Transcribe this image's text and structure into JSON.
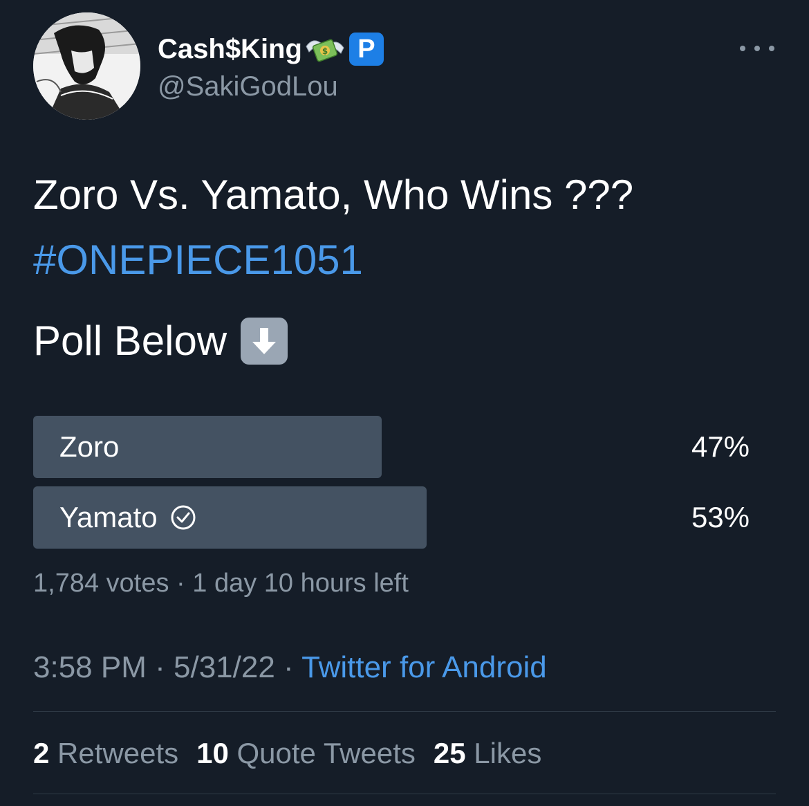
{
  "author": {
    "display_name": "Cash$King",
    "handle": "@SakiGodLou",
    "badge_letter": "P",
    "name_emoji": "money-with-wings-icon"
  },
  "tweet": {
    "text": "Zoro Vs. Yamato, Who Wins ???",
    "hashtag": "#ONEPIECE1051",
    "poll_intro": "Poll Below",
    "poll_intro_emoji": "down-arrow-icon"
  },
  "poll": {
    "options": [
      {
        "label": "Zoro",
        "percent_label": "47%",
        "percent": 47,
        "winner": false
      },
      {
        "label": "Yamato",
        "percent_label": "53%",
        "percent": 53,
        "winner": true
      }
    ],
    "votes": "1,784 votes",
    "separator": "·",
    "time_left": "1 day 10 hours left"
  },
  "meta": {
    "time": "3:58 PM",
    "separator": "·",
    "date": "5/31/22",
    "source": "Twitter for Android"
  },
  "stats": {
    "retweets_count": "2",
    "retweets_label": "Retweets",
    "quotes_count": "10",
    "quotes_label": "Quote Tweets",
    "likes_count": "25",
    "likes_label": "Likes"
  },
  "colors": {
    "background": "#151d28",
    "accent_blue": "#4a99e9",
    "muted_text": "#8b98a5",
    "poll_bar": "#445262"
  }
}
